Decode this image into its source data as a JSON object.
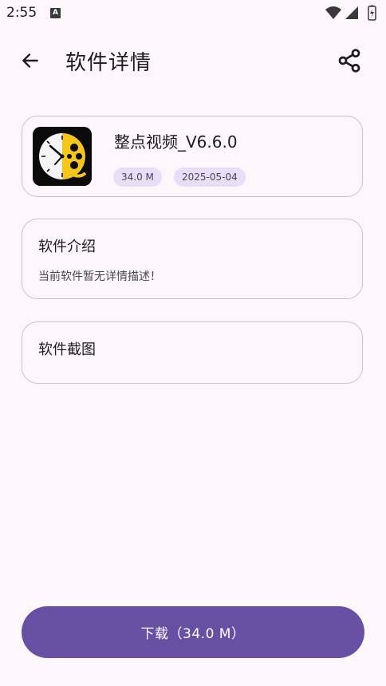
{
  "status_bar": {
    "time": "2:55",
    "notification_icon": "a-notification-icon",
    "icons": [
      "wifi-icon",
      "signal-icon",
      "battery-icon"
    ]
  },
  "app_bar": {
    "title": "软件详情",
    "back_icon": "arrow-left-icon",
    "share_icon": "share-icon"
  },
  "app_info": {
    "name": "整点视频_V6.6.0",
    "size": "34.0 M",
    "date": "2025-05-04",
    "icon": "app-clock-film-icon"
  },
  "intro": {
    "title": "软件介绍",
    "description": "当前软件暂无详情描述！"
  },
  "screenshots": {
    "title": "软件截图"
  },
  "download_button": {
    "label": "下载（34.0 M）"
  },
  "colors": {
    "background": "#FDF7FC",
    "primary": "#6750A4",
    "chip_bg": "#E8DEF8",
    "outline": "#CAC4D0",
    "app_icon_yellow": "#F5C518"
  }
}
